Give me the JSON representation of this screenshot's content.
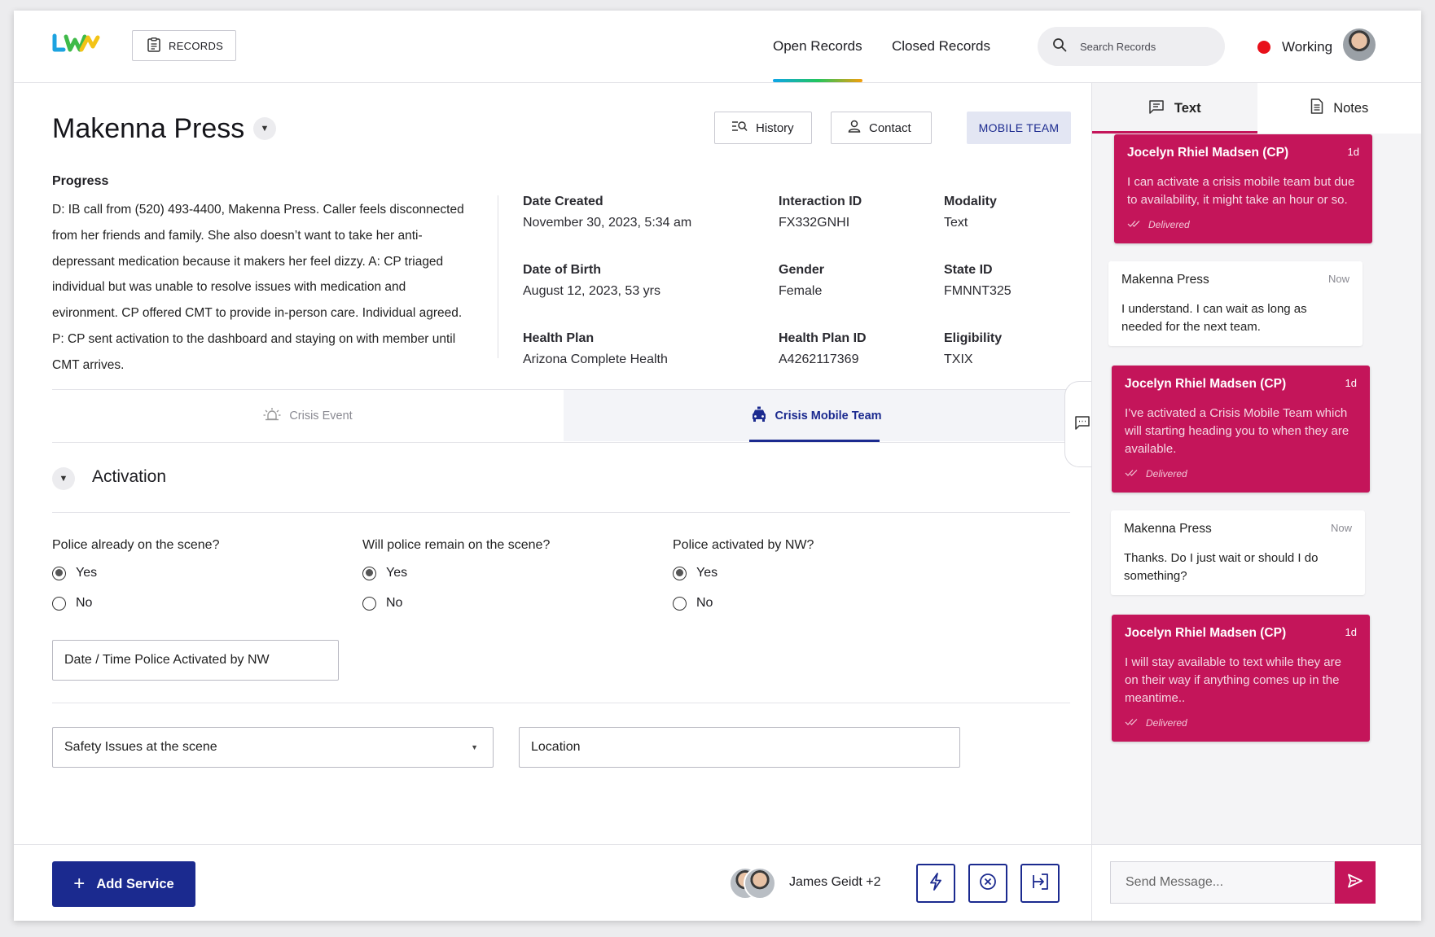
{
  "header": {
    "records_label": "RECORDS",
    "nav": [
      "Open Records",
      "Closed Records"
    ],
    "search_placeholder": "Search Records",
    "status": "Working"
  },
  "record": {
    "name": "Makenna Press",
    "buttons": {
      "history": "History",
      "contact": "Contact",
      "mobile_team": "MOBILE TEAM"
    },
    "progress_title": "Progress",
    "progress_text": "D: IB call from (520) 493-4400, Makenna Press. Caller feels disconnected from her friends and family. She also doesn’t want to take her anti-depressant medication because it makers her feel dizzy. A: CP triaged individual but was unable to resolve issues with medication and evironment. CP offered CMT to provide in-person care. Individual agreed. P:  CP sent activation to the dashboard and staying on with member until CMT arrives.",
    "fields": [
      {
        "label": "Date Created",
        "value": "November 30, 2023, 5:34 am"
      },
      {
        "label": "Interaction ID",
        "value": "FX332GNHI"
      },
      {
        "label": "Modality",
        "value": "Text"
      },
      {
        "label": "Date of Birth",
        "value": "August 12, 2023, 53 yrs"
      },
      {
        "label": "Gender",
        "value": "Female"
      },
      {
        "label": "State ID",
        "value": "FMNNT325"
      },
      {
        "label": "Health Plan",
        "value": "Arizona Complete Health"
      },
      {
        "label": "Health Plan ID",
        "value": "A4262117369"
      },
      {
        "label": "Eligibility",
        "value": "TXIX"
      }
    ]
  },
  "subtabs": {
    "crisis_event": "Crisis Event",
    "crisis_mobile_team": "Crisis Mobile Team"
  },
  "activation": {
    "title": "Activation",
    "questions": [
      {
        "label": "Police already on the scene?",
        "selected": "Yes"
      },
      {
        "label": "Will police remain on the scene?",
        "selected": "Yes"
      },
      {
        "label": "Police activated by NW?",
        "selected": "Yes"
      }
    ],
    "option_yes": "Yes",
    "option_no": "No",
    "datetime_placeholder": "Date / Time Police Activated by NW",
    "safety_placeholder": "Safety Issues at the scene",
    "location_placeholder": "Location"
  },
  "bottom": {
    "add_service": "Add Service",
    "team_name": "James Geidt +2"
  },
  "panel": {
    "tabs": [
      "Text",
      "Notes"
    ],
    "messages": [
      {
        "dir": "out",
        "sender": "Jocelyn Rhiel Madsen (CP)",
        "time": "1d",
        "body": "I can activate a crisis mobile team but due to availability, it might take an hour or so.",
        "status": "Delivered"
      },
      {
        "dir": "in",
        "sender": "Makenna Press",
        "time": "Now",
        "body": "I understand. I can wait as long as needed for the next team."
      },
      {
        "dir": "out",
        "sender": "Jocelyn Rhiel Madsen (CP)",
        "time": "1d",
        "body": "I’ve activated a Crisis Mobile Team which will starting heading you to when they are available.",
        "status": "Delivered"
      },
      {
        "dir": "in",
        "sender": "Makenna Press",
        "time": "Now",
        "body": "Thanks. Do I just wait or should I do something?"
      },
      {
        "dir": "out",
        "sender": "Jocelyn Rhiel Madsen (CP)",
        "time": "1d",
        "body": "I will stay available to text while they are on their way if anything comes up in the meantime..",
        "status": "Delivered"
      }
    ],
    "send_placeholder": "Send Message..."
  },
  "colors": {
    "primary": "#1b2a8f",
    "accent": "#c4155a",
    "status_working": "#e8101a"
  }
}
